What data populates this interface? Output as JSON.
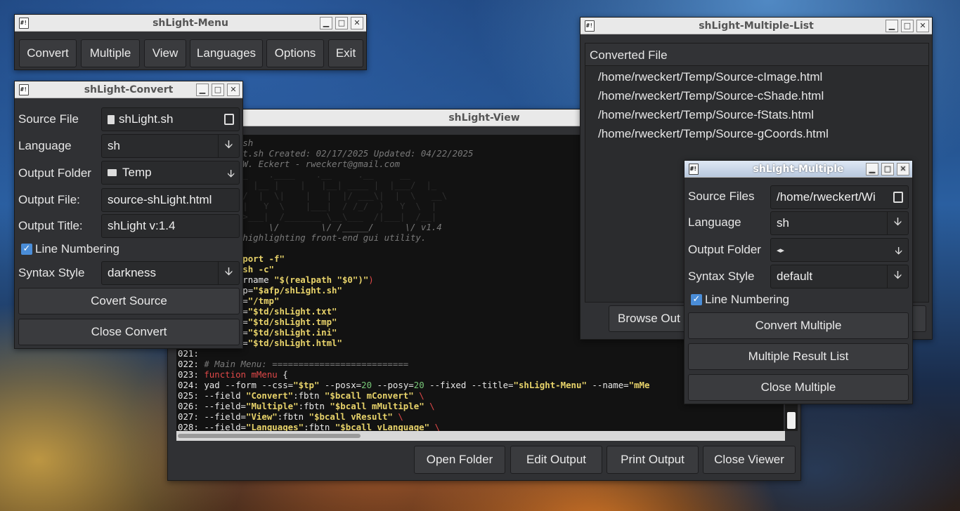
{
  "menu_window": {
    "title": "shLight-Menu",
    "buttons": [
      "Convert",
      "Multiple",
      "View",
      "Languages",
      "Options",
      "Exit"
    ]
  },
  "convert_window": {
    "title": "shLight-Convert",
    "source_file_label": "Source File",
    "source_file_value": "shLight.sh",
    "language_label": "Language",
    "language_value": "sh",
    "output_folder_label": "Output Folder",
    "output_folder_value": "Temp",
    "output_file_label": "Output File:",
    "output_file_value": "source-shLight.html",
    "output_title_label": "Output Title:",
    "output_title_value": "shLight v:1.4",
    "line_numbering_label": "Line Numbering",
    "line_numbering_checked": true,
    "syntax_style_label": "Syntax Style",
    "syntax_style_value": "darkness",
    "convert_button": "Covert Source",
    "close_button": "Close Convert"
  },
  "view_window": {
    "title": "shLight-View",
    "code_lines": [
      {
        "n": "",
        "parts": [
          {
            "t": "bash",
            "c": "c-com"
          }
        ]
      },
      {
        "n": "",
        "parts": [
          {
            "t": "ght.sh Created: 02/17/2025 Updated: 04/22/2025",
            "c": "c-com"
          }
        ]
      },
      {
        "n": "",
        "parts": [
          {
            "t": "t W. Eckert - rweckert@gmail.com",
            "c": "c-com"
          }
        ]
      },
      {
        "n": "",
        "parts": [
          {
            "t": ".__    .____    .__     .__     __",
            "c": "c-art"
          }
        ]
      },
      {
        "n": "",
        "parts": [
          {
            "t": "_|  |__ |    |   |__| ____ |  |___/  |_",
            "c": "c-art"
          }
        ]
      },
      {
        "n": "",
        "parts": [
          {
            "t": "__/  |  \\|    |   |  |/ ___\\|  |  \\   __\\",
            "c": "c-art"
          }
        ]
      },
      {
        "n": "",
        "parts": [
          {
            "t": " \\|   Y  \\    |___|  / /_/  )   Y  \\  |",
            "c": "c-art"
          }
        ]
      },
      {
        "n": "",
        "parts": [
          {
            "t": "  >___|  /_______ \\__\\___  /|___|  /__|",
            "c": "c-art"
          }
        ]
      },
      {
        "n": "",
        "parts": [
          {
            "t": "\\/     \\/        \\/ /_____/      \\/ v1.4",
            "c": "c-com"
          }
        ]
      },
      {
        "n": "",
        "parts": [
          {
            "t": "e highlighting front-end gui utility.",
            "c": "c-com"
          }
        ]
      },
      {
        "n": "",
        "parts": [
          {
            "t": "",
            "c": ""
          }
        ]
      },
      {
        "n": "",
        "parts": [
          {
            "t": "export -f\"",
            "c": "c-str"
          }
        ]
      },
      {
        "n": "",
        "parts": [
          {
            "t": "bash -c\"",
            "c": "c-str"
          }
        ]
      },
      {
        "n": "",
        "parts": [
          {
            "t": "dirname ",
            "c": ""
          },
          {
            "t": "\"$(realpath \"$0\")\"",
            "c": "c-str"
          },
          {
            "t": ")",
            "c": "c-kw"
          }
        ]
      },
      {
        "n": "",
        "parts": [
          {
            "t": "app=",
            "c": ""
          },
          {
            "t": "\"$afp/shLight.sh\"",
            "c": "c-str"
          }
        ]
      },
      {
        "n": "",
        "parts": [
          {
            "t": "td=",
            "c": ""
          },
          {
            "t": "\"/tmp\"",
            "c": "c-str"
          }
        ]
      },
      {
        "n": "",
        "parts": [
          {
            "t": "tf=",
            "c": ""
          },
          {
            "t": "\"$td/shLight.txt\"",
            "c": "c-str"
          }
        ]
      },
      {
        "n": "",
        "parts": [
          {
            "t": "tt=",
            "c": ""
          },
          {
            "t": "\"$td/shLight.tmp\"",
            "c": "c-str"
          }
        ]
      },
      {
        "n": "",
        "parts": [
          {
            "t": "ti=",
            "c": ""
          },
          {
            "t": "\"$td/shLight.ini\"",
            "c": "c-str"
          }
        ]
      },
      {
        "n": "",
        "parts": [
          {
            "t": "th=",
            "c": ""
          },
          {
            "t": "\"$td/shLight.html\"",
            "c": "c-str"
          }
        ]
      },
      {
        "n": "021:",
        "parts": [
          {
            "t": "",
            "c": ""
          }
        ]
      },
      {
        "n": "022:",
        "parts": [
          {
            "t": "# Main Menu: ==========================",
            "c": "c-com"
          }
        ]
      },
      {
        "n": "023:",
        "parts": [
          {
            "t": "function ",
            "c": "c-kw"
          },
          {
            "t": "mMenu ",
            "c": "c-kw"
          },
          {
            "t": "{",
            "c": ""
          }
        ]
      },
      {
        "n": "024:",
        "parts": [
          {
            "t": "yad --form --css=",
            "c": ""
          },
          {
            "t": "\"$tp\"",
            "c": "c-str"
          },
          {
            "t": " --posx=",
            "c": ""
          },
          {
            "t": "20",
            "c": "c-num"
          },
          {
            "t": " --posy=",
            "c": ""
          },
          {
            "t": "20",
            "c": "c-num"
          },
          {
            "t": " --fixed --title=",
            "c": ""
          },
          {
            "t": "\"shLight-Menu\"",
            "c": "c-str"
          },
          {
            "t": " --name=",
            "c": ""
          },
          {
            "t": "\"mMe",
            "c": "c-str"
          }
        ]
      },
      {
        "n": "025:",
        "parts": [
          {
            "t": "--field ",
            "c": ""
          },
          {
            "t": "\"Convert\"",
            "c": "c-str"
          },
          {
            "t": ":fbtn ",
            "c": ""
          },
          {
            "t": "\"$bcall mConvert\"",
            "c": "c-str"
          },
          {
            "t": " \\",
            "c": "c-kw"
          }
        ]
      },
      {
        "n": "026:",
        "parts": [
          {
            "t": "--field=",
            "c": ""
          },
          {
            "t": "\"Multiple\"",
            "c": "c-str"
          },
          {
            "t": ":fbtn ",
            "c": ""
          },
          {
            "t": "\"$bcall mMultiple\"",
            "c": "c-str"
          },
          {
            "t": " \\",
            "c": "c-kw"
          }
        ]
      },
      {
        "n": "027:",
        "parts": [
          {
            "t": "--field=",
            "c": ""
          },
          {
            "t": "\"View\"",
            "c": "c-str"
          },
          {
            "t": ":fbtn ",
            "c": ""
          },
          {
            "t": "\"$bcall vResult\"",
            "c": "c-str"
          },
          {
            "t": " \\",
            "c": "c-kw"
          }
        ]
      },
      {
        "n": "028:",
        "parts": [
          {
            "t": "--field=",
            "c": ""
          },
          {
            "t": "\"Languages\"",
            "c": "c-str"
          },
          {
            "t": ":fbtn ",
            "c": ""
          },
          {
            "t": "\"$bcall vLanguage\"",
            "c": "c-str"
          },
          {
            "t": " \\",
            "c": "c-kw"
          }
        ]
      }
    ],
    "buttons": [
      "Open Folder",
      "Edit Output",
      "Print Output",
      "Close Viewer"
    ]
  },
  "list_window": {
    "title": "shLight-Multiple-List",
    "header": "Converted File",
    "items": [
      "/home/rweckert/Temp/Source-cImage.html",
      "/home/rweckert/Temp/Source-cShade.html",
      "/home/rweckert/Temp/Source-fStats.html",
      "/home/rweckert/Temp/Source-gCoords.html"
    ],
    "browse_button": "Browse Out"
  },
  "multiple_window": {
    "title": "shLight-Multiple",
    "source_files_label": "Source Files",
    "source_files_value": "/home/rweckert/Wi",
    "language_label": "Language",
    "language_value": "sh",
    "output_folder_label": "Output Folder",
    "output_folder_value": "",
    "syntax_style_label": "Syntax Style",
    "syntax_style_value": "default",
    "line_numbering_label": "Line Numbering",
    "line_numbering_checked": true,
    "convert_button": "Convert Multiple",
    "result_button": "Multiple Result List",
    "close_button": "Close Multiple"
  },
  "window_controls": {
    "minimize": "▁",
    "maximize": "□",
    "close": "✕"
  }
}
